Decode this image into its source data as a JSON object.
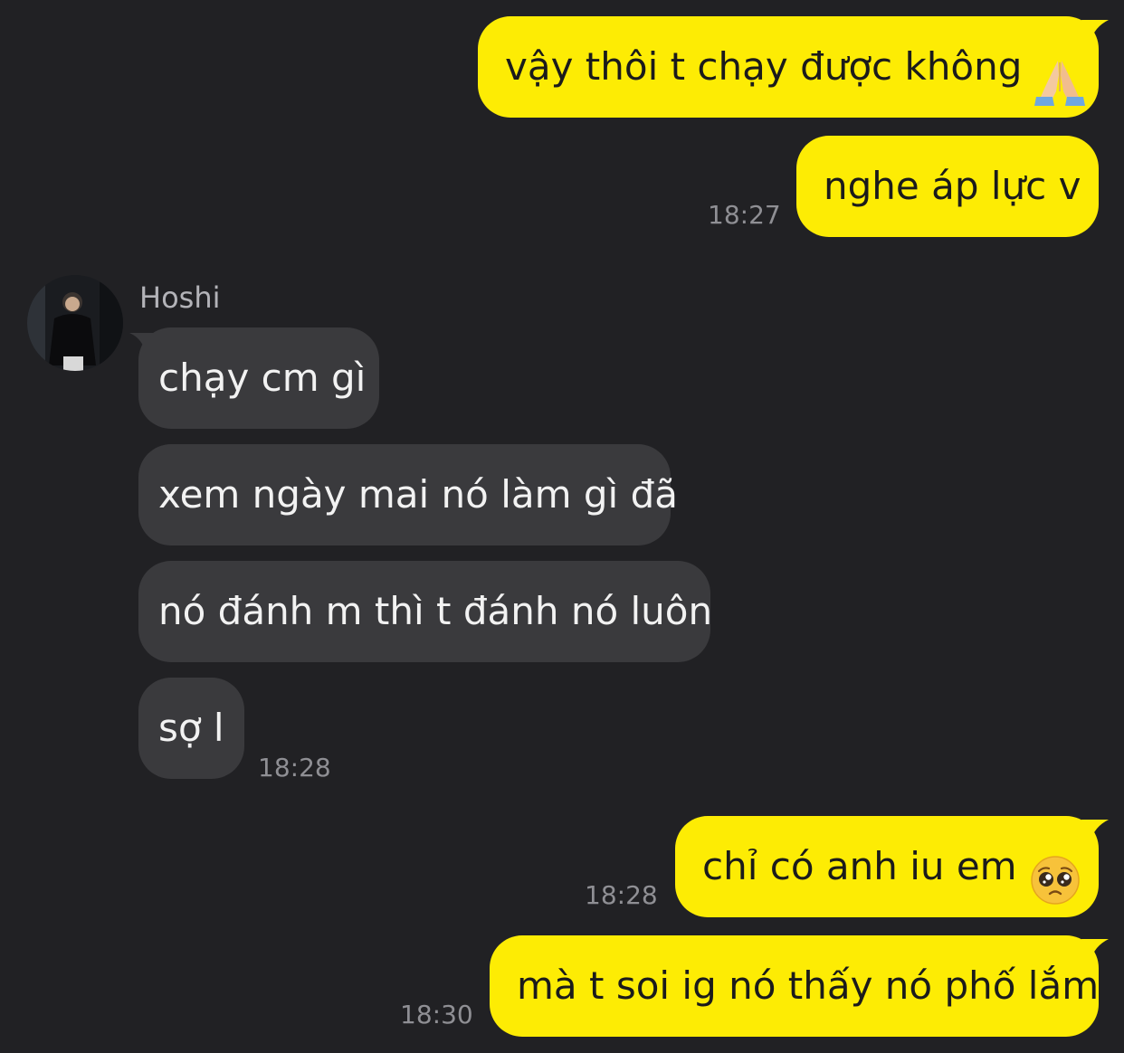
{
  "contact": {
    "name": "Hoshi",
    "avatar_icon": "avatar-photo-icon"
  },
  "colors": {
    "background": "#212124",
    "outgoing_bubble": "#fdec04",
    "incoming_bubble": "#3a3a3d",
    "timestamp": "#8f8f94"
  },
  "messages": [
    {
      "from": "me",
      "text": "vậy thôi t chạy được không",
      "emoji": "folded-hands-icon"
    },
    {
      "from": "me",
      "text": "nghe áp lực v",
      "time": "18:27"
    },
    {
      "from": "Hoshi",
      "text": "chạy cm gì"
    },
    {
      "from": "Hoshi",
      "text": "xem ngày mai nó làm gì đã"
    },
    {
      "from": "Hoshi",
      "text": "nó đánh m thì t đánh nó luôn"
    },
    {
      "from": "Hoshi",
      "text": "sợ l",
      "time": "18:28"
    },
    {
      "from": "me",
      "text": "chỉ có anh iu em",
      "emoji": "pleading-face-icon",
      "time": "18:28"
    },
    {
      "from": "me",
      "text": "mà t soi ig nó thấy nó phố lắm",
      "time": "18:30"
    }
  ]
}
